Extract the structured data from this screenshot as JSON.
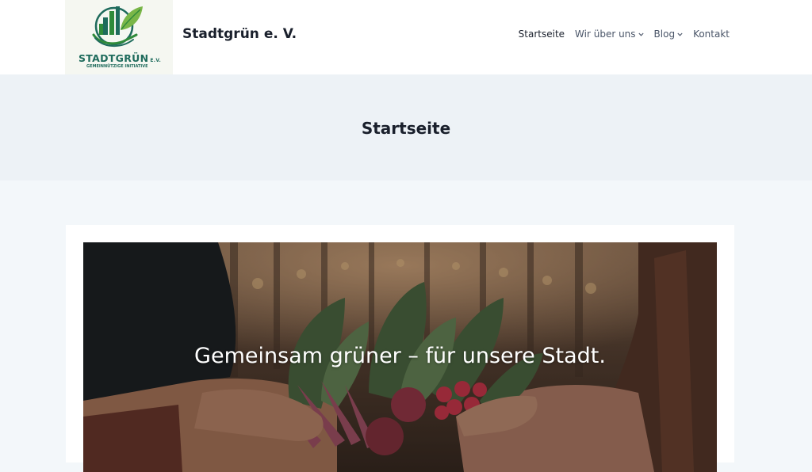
{
  "header": {
    "logo": {
      "icon": "city-leaf-hands-logo",
      "name": "STADTGRÜN",
      "suffix": "E.V.",
      "tagline": "GEMEINNÜTZIGE INITIATIVE",
      "colors": {
        "green": "#2f8a3a",
        "teal": "#1e6b5c",
        "lightgreen": "#7ab648"
      }
    },
    "site_title": "Stadtgrün e. V.",
    "nav": [
      {
        "label": "Startseite",
        "active": true,
        "has_dropdown": false
      },
      {
        "label": "Wir über uns",
        "active": false,
        "has_dropdown": true
      },
      {
        "label": "Blog",
        "active": false,
        "has_dropdown": true
      },
      {
        "label": "Kontakt",
        "active": false,
        "has_dropdown": false
      }
    ]
  },
  "page_title": "Startseite",
  "banner": {
    "heading": "Gemeinsam grüner – für unsere Stadt."
  }
}
